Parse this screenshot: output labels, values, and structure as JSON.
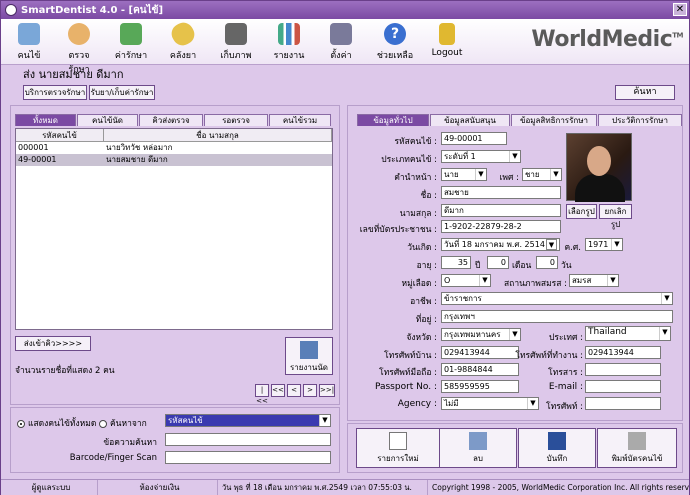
{
  "window": {
    "title": "SmartDentist 4.0 - [คนไข้]",
    "close": "✕"
  },
  "toolbar": {
    "items": [
      "คนไข้",
      "ตรวจรักษา",
      "ค่ารักษา",
      "คลังยา",
      "เก็บภาพ",
      "รายงาน",
      "ตั้งค่า",
      "ช่วยเหลือ",
      "Logout"
    ],
    "logo": "WorldMedic",
    "tm": "TM"
  },
  "patient": {
    "header": "ส่ง  นายสมชาย ดีมาก"
  },
  "buttons": {
    "service": "บริการตรวจรักษา",
    "receive": "รับยา/เก็บค่ารักษา",
    "search": "ค้นหา",
    "send_to_queue": "ส่งเข้าคิว>>>>",
    "report": "รายงานนัด"
  },
  "left_tabs": [
    "ทั้งหมด",
    "คนไข้นัด",
    "คิวส่งตรวจ",
    "รอตรวจ",
    "คนไข้รวม"
  ],
  "grid": {
    "headers": [
      "รหัสคนไข้",
      "ชื่อ นามสกุล"
    ],
    "rows": [
      [
        "000001",
        "นายวิทวัช หล่อมาก"
      ],
      [
        "49-00001",
        "นายสมชาย ดีมาก"
      ]
    ]
  },
  "count_text": "จำนวนรายชื่อที่แสดง 2 คน",
  "nav": [
    "|<<",
    "<<",
    "<",
    ">",
    ">>|"
  ],
  "filter": {
    "show_all": "แสดงคนไข้ทั้งหมด",
    "search_from": "ค้นหาจาก",
    "search_field": "รหัสคนไข้",
    "keyword_label": "ข้อความค้นหา",
    "barcode_label": "Barcode/Finger Scan"
  },
  "right_tabs": [
    "ข้อมูลทั่วไป",
    "ข้อมูลสนับสนุน",
    "ข้อมูลสิทธิการรักษา",
    "ประวัติการรักษา"
  ],
  "form": {
    "patient_id_label": "รหัสคนไข้ :",
    "patient_id": "49-00001",
    "type_label": "ประเภทคนไข้ :",
    "type": "ระดับที่ 1",
    "prefix_label": "คำนำหน้า :",
    "prefix": "นาย",
    "sex_label": "เพศ :",
    "sex": "ชาย",
    "name_label": "ชื่อ :",
    "name": "สมชาย",
    "surname_label": "นามสกุล :",
    "surname": "ดีมาก",
    "idcard_label": "เลขที่บัตรประชาชน :",
    "idcard": "1-9202-22879-28-2",
    "birth_label": "วันเกิด :",
    "birth": "วันที่ 18  มกราคม  พ.ศ.  2514",
    "ce_label": "ค.ศ.",
    "ce": "1971",
    "age_label": "อายุ :",
    "age_y": "35",
    "y_unit": "ปี",
    "age_m": "0",
    "m_unit": "เดือน",
    "age_d": "0",
    "d_unit": "วัน",
    "blood_label": "หมู่เลือด :",
    "blood": "O",
    "marital_label": "สถานภาพสมรส :",
    "marital": "สมรส",
    "job_label": "อาชีพ :",
    "job": "ข้าราชการ",
    "addr_label": "ที่อยู่ :",
    "addr": "กรุงเทพฯ",
    "province_label": "จังหวัด :",
    "province": "กรุงเทพมหานคร",
    "country_label": "ประเทศ :",
    "country": "Thailand",
    "home_tel_label": "โทรศัพท์บ้าน :",
    "home_tel": "029413944",
    "work_tel_label": "โทรศัพท์ที่ทำงาน :",
    "work_tel": "029413944",
    "mobile_label": "โทรศัพท์มือถือ :",
    "mobile": "01-9884844",
    "fax_label": "โทรสาร :",
    "fax": "",
    "passport_label": "Passport No. :",
    "passport": "585959595",
    "email_label": "E-mail :",
    "email": "",
    "agency_label": "Agency :",
    "agency": "ไม่มี",
    "tel_label": "โทรศัพท์ :",
    "tel": "",
    "choose_photo": "เลือกรูป",
    "cancel_photo": "ยกเลิกรูป"
  },
  "actions": [
    "รายการใหม่",
    "ลบ",
    "บันทึก",
    "พิมพ์บัตรคนไข้"
  ],
  "status": {
    "user": "ผู้ดูแลระบบ",
    "room": "ห้องจ่ายเงิน",
    "datetime": "วัน พุธ ที่ 18 เดือน มกราคม พ.ศ.2549 เวลา 07:55:03 น.",
    "copyright": "Copyright 1998 - 2005, WorldMedic Corporation Inc. All rights reserved."
  }
}
